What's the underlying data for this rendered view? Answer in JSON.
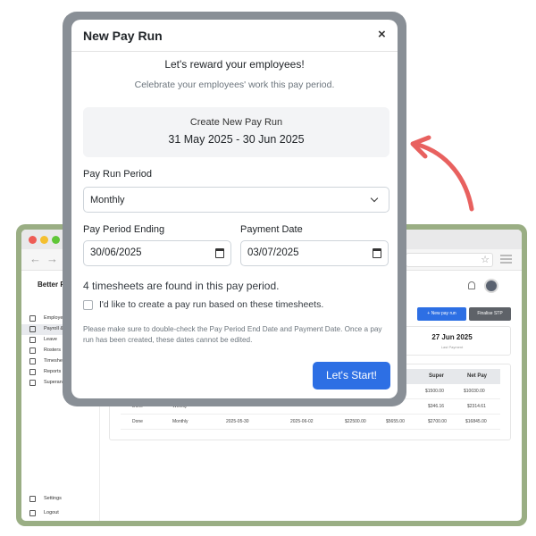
{
  "background_app": {
    "brand": "Better P",
    "sidebar": {
      "items": [
        {
          "label": "Employees",
          "icon": "users-icon"
        },
        {
          "label": "Payroll &",
          "icon": "wallet-icon",
          "active": true
        },
        {
          "label": "Leave",
          "icon": "calendar-icon"
        },
        {
          "label": "Rosters",
          "icon": "roster-icon"
        },
        {
          "label": "Timesheets",
          "icon": "clipboard-icon"
        },
        {
          "label": "Reports",
          "icon": "report-icon"
        },
        {
          "label": "Superannuation",
          "icon": "shield-icon"
        }
      ],
      "bottom_items": [
        {
          "label": "Settings",
          "icon": "gear-icon"
        },
        {
          "label": "Logout",
          "icon": "logout-icon"
        }
      ]
    },
    "actions": {
      "new_pay_run": "+ New pay run",
      "finalise_stp": "Finalise STP"
    },
    "summary": {
      "date": "27 Jun 2025",
      "caption": "Last Payment"
    },
    "table": {
      "columns": [
        "Super",
        "Net Pay"
      ],
      "rows": [
        [
          "",
          "",
          "",
          "",
          "",
          "$1500.00",
          "$10030.00"
        ],
        [
          "Done",
          "Weekly",
          "",
          "",
          "",
          "$346.16",
          "$2314.61"
        ],
        [
          "Done",
          "Monthly",
          "2025-05-30",
          "2025-06-02",
          "$22500.00",
          "$5655.00",
          "$2700.00",
          "$16845.00"
        ]
      ]
    }
  },
  "accent_colors": {
    "primary": "#2d6fe4",
    "arrow": "#e8615f",
    "frame_green": "#9aae84",
    "modal_frame": "#898f96"
  },
  "modal": {
    "title": "New Pay Run",
    "close_icon": "×",
    "heading": "Let's reward your employees!",
    "subheading": "Celebrate your employees' work this pay period.",
    "create_label": "Create New Pay Run",
    "create_range": "31 May 2025 - 30 Jun 2025",
    "period_label": "Pay Run Period",
    "period_value": "Monthly",
    "ending_label": "Pay Period Ending",
    "ending_value": "30/06/2025",
    "payment_label": "Payment Date",
    "payment_value": "03/07/2025",
    "timesheets_text": "4 timesheets are found in this pay period.",
    "checkbox_label": "I'd like to create a pay run based on these timesheets.",
    "checkbox_checked": false,
    "note": "Please make sure to double-check the Pay Period End Date and Payment Date. Once a pay run has been created, these dates cannot be edited.",
    "start_button": "Let's Start!"
  }
}
